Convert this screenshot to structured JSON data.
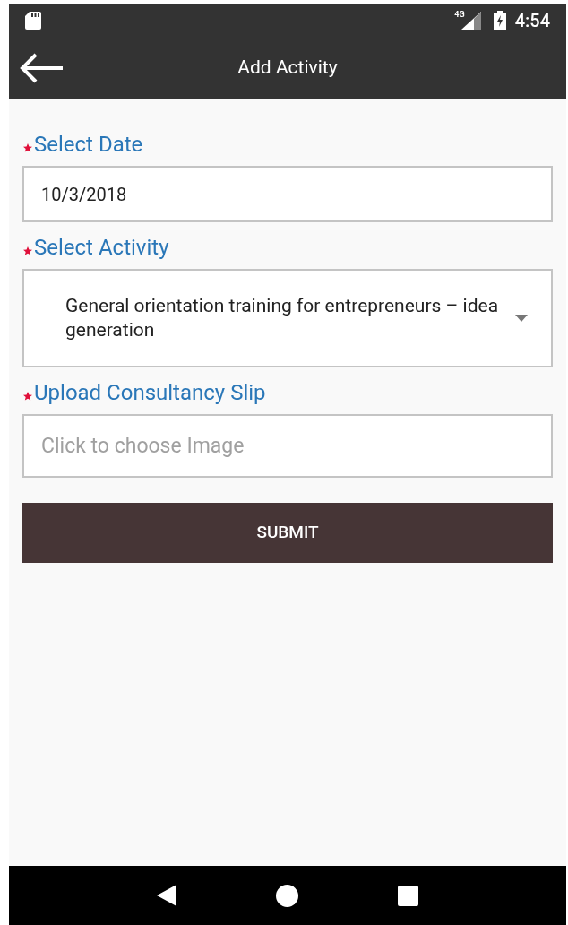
{
  "status_bar": {
    "network": "4G",
    "time": "4:54"
  },
  "app_bar": {
    "title": "Add Activity"
  },
  "fields": [
    {
      "kind": "date",
      "label": "Select Date",
      "required": true,
      "value": "10/3/2018"
    },
    {
      "kind": "select",
      "label": "Select Activity",
      "required": true,
      "value": "General orientation training for entrepreneurs – idea generation"
    },
    {
      "kind": "upload",
      "label": "Upload Consultancy Slip",
      "required": true,
      "placeholder": "Click to choose Image"
    }
  ],
  "submit": {
    "label": "SUBMIT"
  }
}
